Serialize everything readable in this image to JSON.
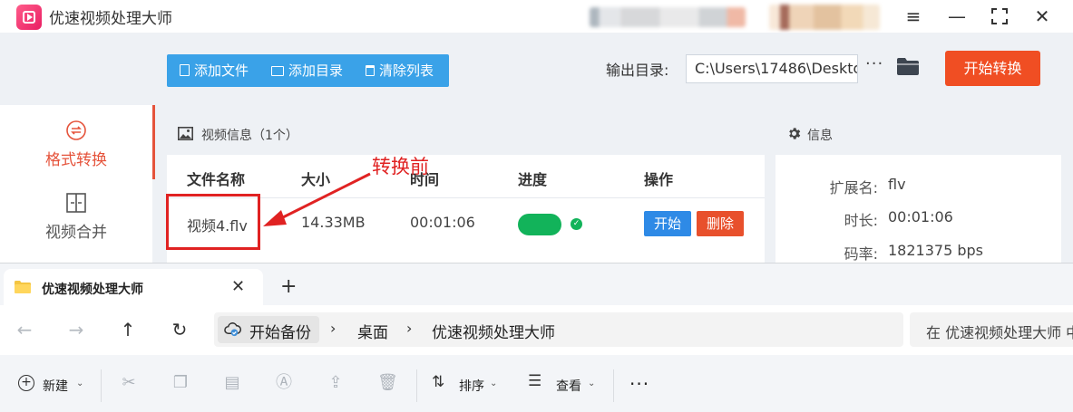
{
  "app": {
    "title": "优速视频处理大师",
    "toolbar": {
      "add_file": "添加文件",
      "add_dir": "添加目录",
      "clear_list": "清除列表",
      "output_label": "输出目录:",
      "output_path": "C:\\Users\\17486\\Deskto",
      "more": "···",
      "start_convert": "开始转换"
    },
    "sidebar": {
      "items": [
        {
          "label": "格式转换",
          "active": true
        },
        {
          "label": "视频合并",
          "active": false
        }
      ]
    },
    "video_panel": {
      "title": "视频信息（1个）",
      "columns": [
        "文件名称",
        "大小",
        "时间",
        "进度",
        "操作"
      ],
      "rows": [
        {
          "name": "视频4.flv",
          "size": "14.33MB",
          "duration": "00:01:06",
          "progress": 1.0,
          "start": "开始",
          "delete": "删除"
        }
      ]
    },
    "annotation": {
      "text": "转换前"
    },
    "info_panel": {
      "title": "信息",
      "rows": [
        {
          "key": "扩展名:",
          "value": "flv"
        },
        {
          "key": "时长:",
          "value": "00:01:06"
        },
        {
          "key": "码率:",
          "value": "1821375 bps"
        }
      ]
    },
    "colors": {
      "accent": "#3aa2e8",
      "danger": "#f04e23",
      "progress": "#12b35a",
      "annotation": "#e02222"
    }
  },
  "explorer": {
    "tab_title": "优速视频处理大师",
    "breadcrumb": [
      "开始备份",
      "桌面",
      "优速视频处理大师"
    ],
    "search_placeholder": "在 优速视频处理大师 中",
    "commands": {
      "new": "新建",
      "sort": "排序",
      "view": "查看"
    }
  }
}
